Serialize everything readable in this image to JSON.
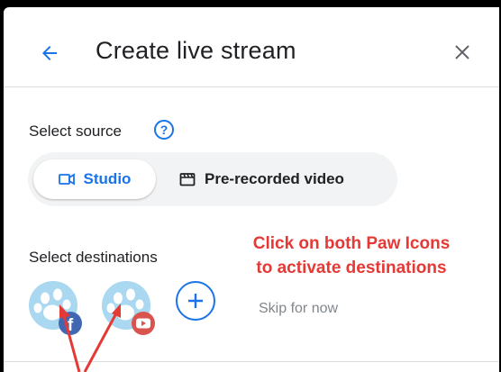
{
  "header": {
    "title": "Create live stream"
  },
  "source": {
    "label": "Select source",
    "options": [
      {
        "label": "Studio",
        "selected": true
      },
      {
        "label": "Pre-recorded video",
        "selected": false
      }
    ]
  },
  "destinations": {
    "label": "Select destinations",
    "items": [
      {
        "icon": "paw-facebook-icon",
        "badge": "f"
      },
      {
        "icon": "paw-youtube-icon"
      }
    ],
    "skip_label": "Skip for now"
  },
  "annotation": {
    "line1": "Click on both Paw Icons",
    "line2": "to activate destinations"
  },
  "colors": {
    "accent": "#1a73e8",
    "annotation": "#e53935",
    "paw": "#a9d8f0",
    "facebook": "#4267b2",
    "youtube": "#d9534f"
  }
}
